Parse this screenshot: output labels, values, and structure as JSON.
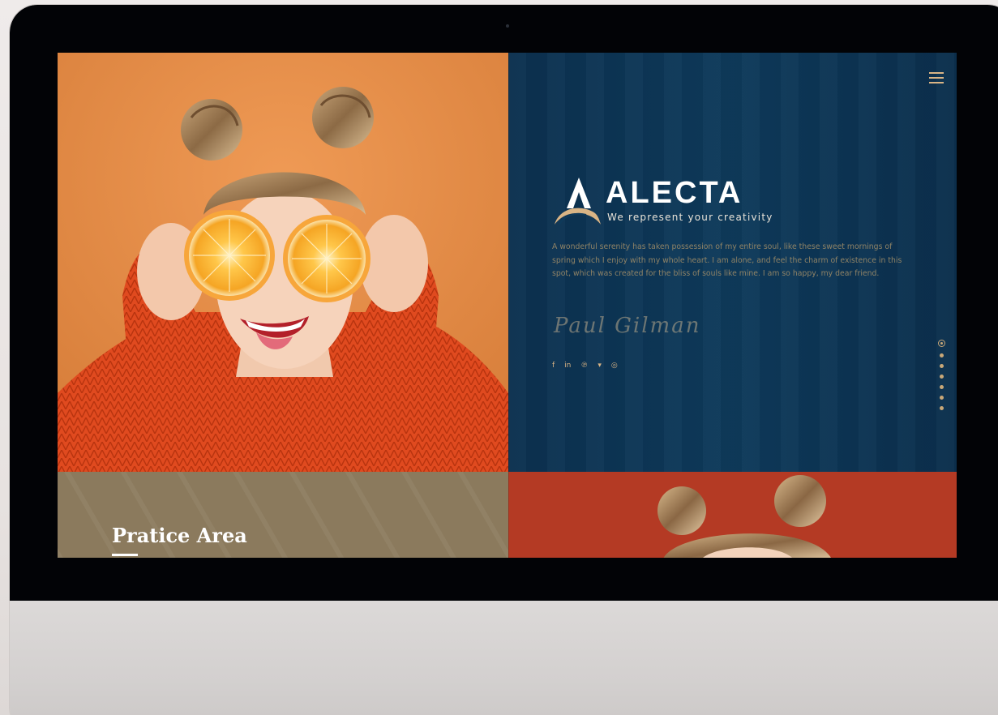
{
  "brand": {
    "name": "ALECTA",
    "tagline": "We represent your creativity",
    "intro": "A wonderful serenity has taken possession of my entire soul, like these sweet mornings of spring which I enjoy with my whole heart. I am alone, and feel the charm of existence in this spot, which was created for the bliss of souls like mine. I am so happy, my dear friend.",
    "signature": "Paul Gilman"
  },
  "socials": [
    {
      "icon": "facebook-icon",
      "glyph": "f"
    },
    {
      "icon": "linkedin-icon",
      "glyph": "in"
    },
    {
      "icon": "pinterest-icon",
      "glyph": "℗"
    },
    {
      "icon": "twitter-icon",
      "glyph": "▾"
    },
    {
      "icon": "instagram-icon",
      "glyph": "◎"
    }
  ],
  "pagination": {
    "count": 7,
    "active_index": 0
  },
  "practice": {
    "title": "Pratice Area"
  },
  "colors": {
    "accent": "#d9b485",
    "brand_panel": "#0e3a5b",
    "photo_panel": "#e48b45",
    "practice_panel": "#8b7a5d",
    "photo2_panel": "#b43a24"
  }
}
